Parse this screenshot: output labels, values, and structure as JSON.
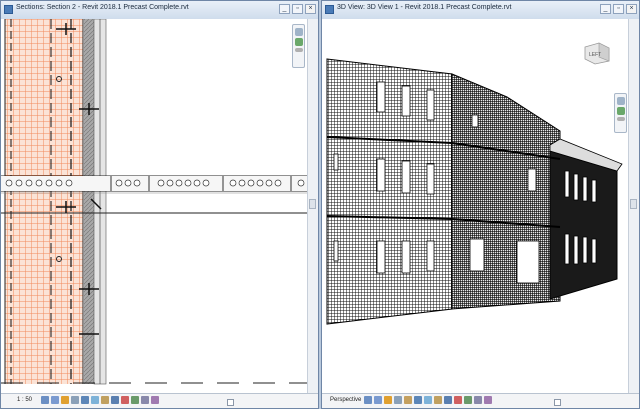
{
  "left_window": {
    "title": "Sections: Section 2 - Revit 2018.1 Precast Complete.rvt",
    "scale": "1 : 50",
    "controls": {
      "minimize": "_",
      "restore": "▫",
      "close": "×"
    }
  },
  "right_window": {
    "title": "3D View: 3D View 1 - Revit 2018.1 Precast Complete.rvt",
    "projection": "Perspective",
    "viewcube_label": "LEFT",
    "controls": {
      "minimize": "_",
      "restore": "▫",
      "close": "×"
    }
  },
  "colors": {
    "section_grid": "#f28a5a",
    "precast_wall": "#9a9a9a",
    "building_mesh": "#111111",
    "title_bar": "#dbe6f3"
  },
  "icons": {
    "statusbar": [
      "detail-level-icon",
      "visual-style-icon",
      "sun-path-icon",
      "shadows-icon",
      "render-icon",
      "crop-region-icon",
      "show-crop-icon",
      "lock-view-icon",
      "temp-hide-icon",
      "reveal-hidden-icon",
      "worksharing-icon",
      "analytical-model-icon",
      "highlight-displacement-icon"
    ],
    "navbar": [
      "steering-wheel-icon",
      "zoom-region-icon",
      "zoom-menu-icon"
    ]
  }
}
